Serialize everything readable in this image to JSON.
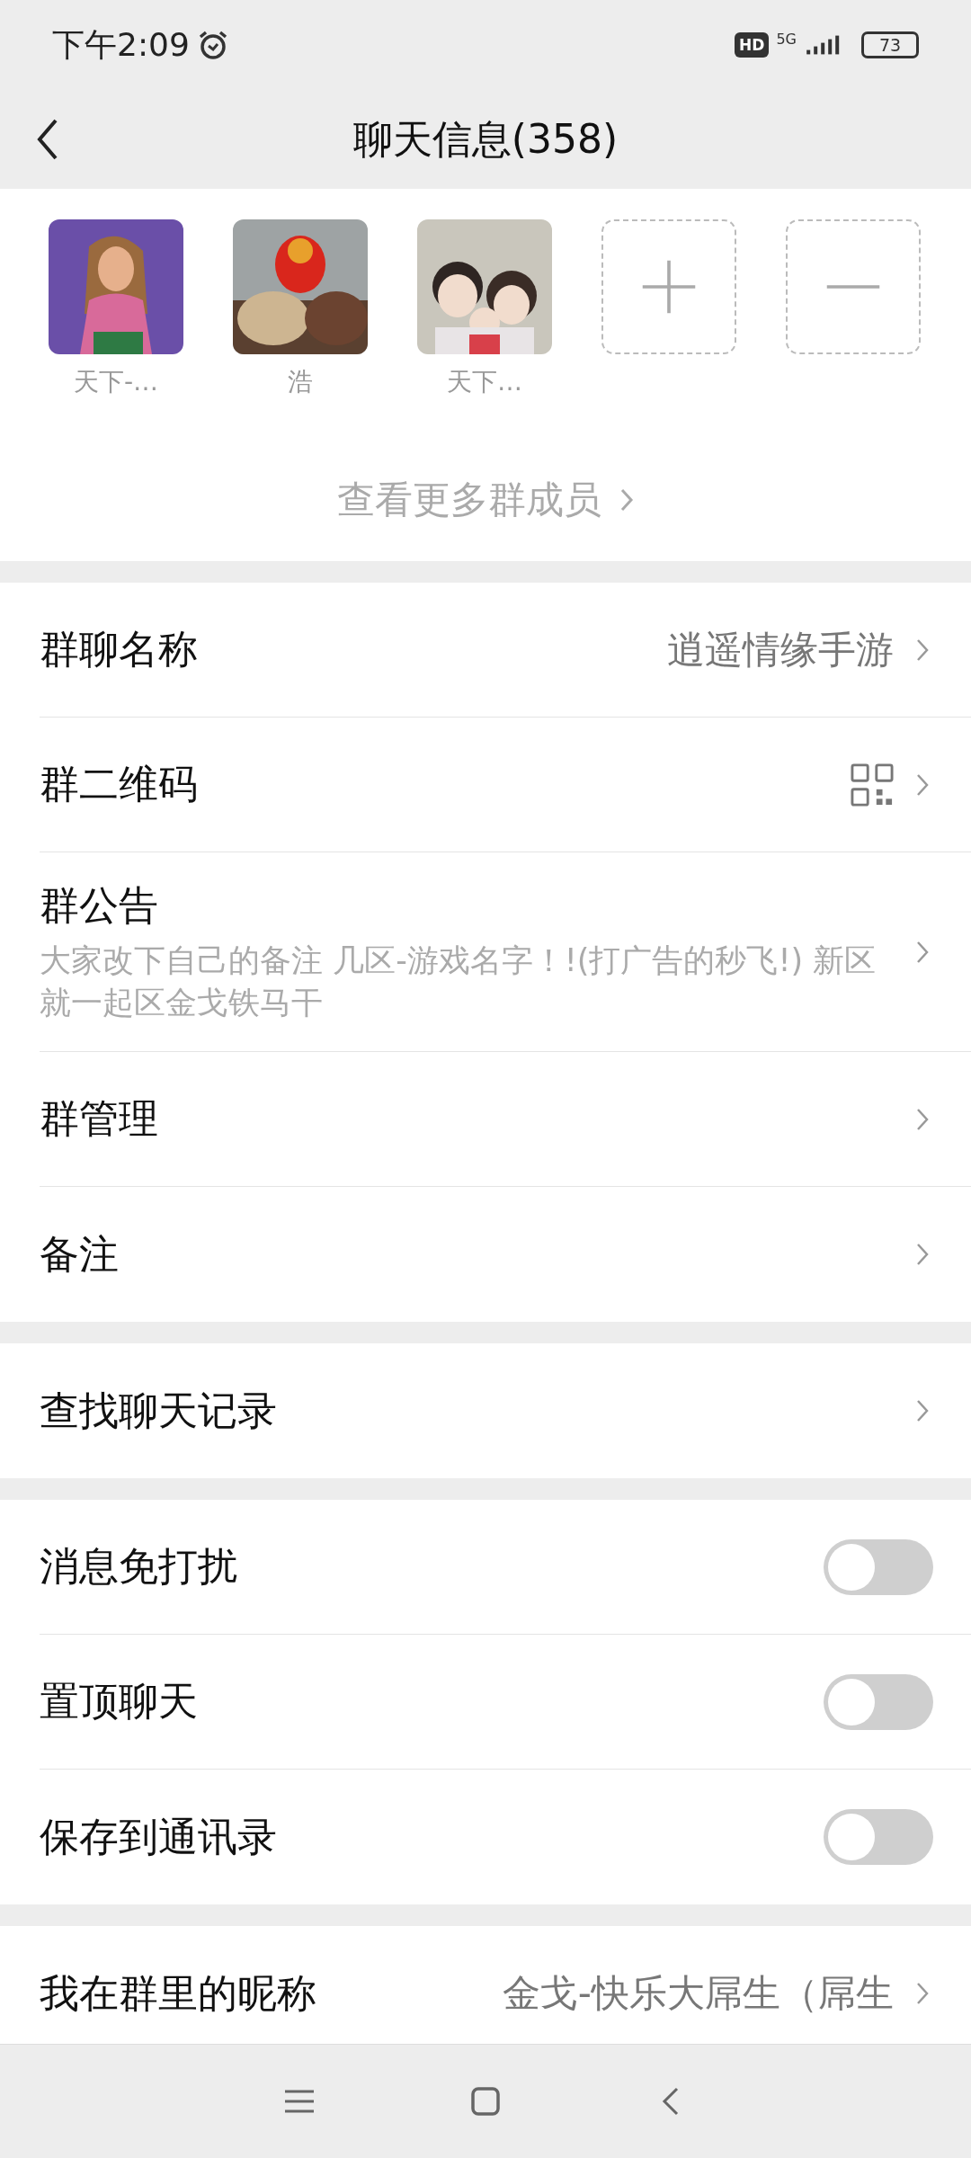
{
  "status_bar": {
    "time": "下午2:09",
    "hd": "HD",
    "network": "5G",
    "battery": "73"
  },
  "header": {
    "title": "聊天信息(358)"
  },
  "members": [
    {
      "name": "天下-…"
    },
    {
      "name": "浩"
    },
    {
      "name": "天下…"
    }
  ],
  "more_members": "查看更多群成员",
  "sections": [
    {
      "rows": [
        {
          "kind": "value",
          "label": "群聊名称",
          "value": "逍遥情缘手游"
        },
        {
          "kind": "qr",
          "label": "群二维码"
        },
        {
          "kind": "notice",
          "label": "群公告",
          "text": "大家改下自己的备注 几区-游戏名字！!(打广告的秒飞!) 新区就一起区金戈铁马干"
        },
        {
          "kind": "plain",
          "label": "群管理"
        },
        {
          "kind": "plain",
          "label": "备注"
        }
      ]
    },
    {
      "rows": [
        {
          "kind": "plain",
          "label": "查找聊天记录"
        }
      ]
    },
    {
      "rows": [
        {
          "kind": "toggle",
          "label": "消息免打扰",
          "on": false
        },
        {
          "kind": "toggle",
          "label": "置顶聊天",
          "on": false
        },
        {
          "kind": "toggle",
          "label": "保存到通讯录",
          "on": false
        }
      ]
    },
    {
      "rows": [
        {
          "kind": "value",
          "label": "我在群里的昵称",
          "value": "金戈-快乐大屌生（屌生"
        }
      ]
    }
  ]
}
